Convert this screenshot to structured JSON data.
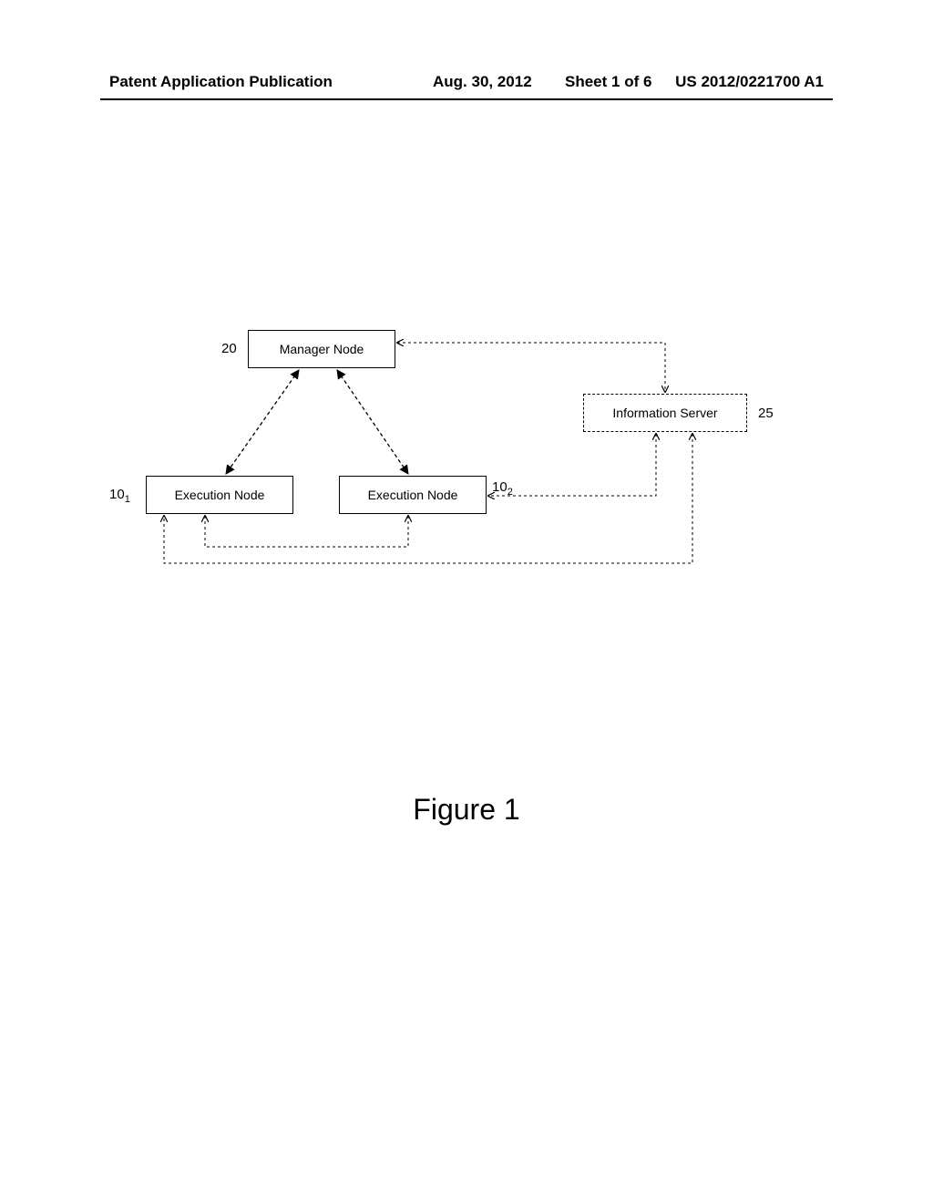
{
  "header": {
    "pub_label": "Patent Application Publication",
    "date": "Aug. 30, 2012",
    "sheet": "Sheet 1 of 6",
    "pub_number": "US 2012/0221700 A1"
  },
  "nodes": {
    "manager": {
      "label": "Manager Node",
      "ref": "20"
    },
    "info_server": {
      "label": "Information Server",
      "ref": "25"
    },
    "exec1": {
      "label": "Execution Node",
      "ref_base": "10",
      "ref_sub": "1"
    },
    "exec2": {
      "label": "Execution Node",
      "ref_base": "10",
      "ref_sub": "2"
    }
  },
  "figure_caption": "Figure 1"
}
